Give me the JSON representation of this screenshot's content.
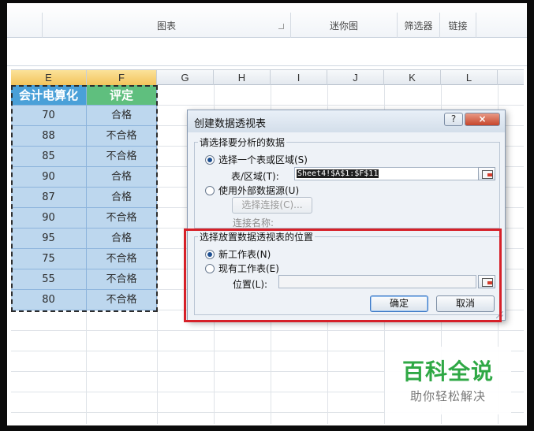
{
  "ribbon": {
    "groups": [
      {
        "label": "",
        "has_launcher": false
      },
      {
        "label": "图表",
        "has_launcher": true
      },
      {
        "label": "迷你图",
        "has_launcher": false
      },
      {
        "label": "筛选器",
        "has_launcher": false
      },
      {
        "label": "链接",
        "has_launcher": false
      },
      {
        "label": "",
        "has_launcher": false
      }
    ]
  },
  "sheet": {
    "columns": [
      "E",
      "F",
      "G",
      "H",
      "I",
      "J",
      "K",
      "L"
    ],
    "selected_columns": [
      "E",
      "F"
    ],
    "header_row": [
      "会计电算化",
      "评定"
    ],
    "rows": [
      [
        "70",
        "合格"
      ],
      [
        "88",
        "不合格"
      ],
      [
        "85",
        "不合格"
      ],
      [
        "90",
        "合格"
      ],
      [
        "87",
        "合格"
      ],
      [
        "90",
        "不合格"
      ],
      [
        "95",
        "合格"
      ],
      [
        "75",
        "不合格"
      ],
      [
        "55",
        "不合格"
      ],
      [
        "80",
        "不合格"
      ]
    ],
    "colors": {
      "header_e": "#4aa0d8",
      "header_f": "#5fbf7e",
      "data_fill": "#bdd7ee"
    }
  },
  "dialog": {
    "title": "创建数据透视表",
    "help_label": "?",
    "close_label": "×",
    "section1": {
      "label": "请选择要分析的数据",
      "option_table": "选择一个表或区域(S)",
      "table_range_label": "表/区域(T):",
      "table_range_value": "Sheet4!$A$1:$F$11",
      "option_external": "使用外部数据源(U)",
      "choose_conn_label": "选择连接(C)...",
      "conn_name_label": "连接名称:"
    },
    "section2": {
      "label": "选择放置数据透视表的位置",
      "option_new": "新工作表(N)",
      "option_existing": "现有工作表(E)",
      "location_label": "位置(L):",
      "location_value": ""
    },
    "ok_label": "确定",
    "cancel_label": "取消",
    "highlight_color": "#d62028"
  },
  "watermark": {
    "title": "百科全说",
    "subtitle": "助你轻松解决"
  }
}
